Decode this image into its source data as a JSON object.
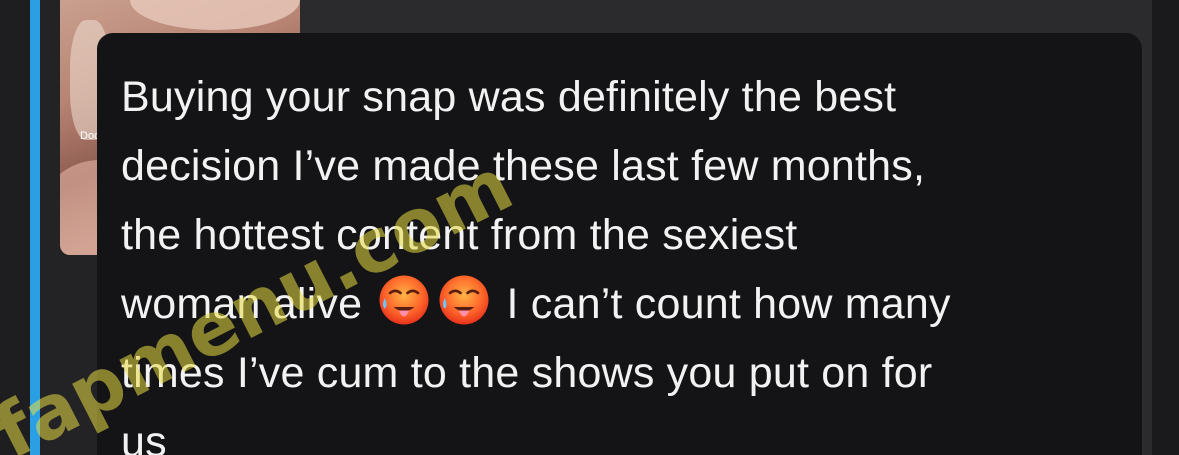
{
  "thumbnail": {
    "label": "Doc"
  },
  "message": {
    "line1": "Buying your snap was definitely the best",
    "line2": "decision I’ve made these last few months,",
    "line3": "the hottest content from the sexiest",
    "line4_start": "woman alive ",
    "line4_end": " I can’t count how many",
    "line5": "times I’ve cum to the shows you put on for",
    "line6": "us",
    "emoji_icons": [
      "drooling-hot-face-emoji",
      "drooling-hot-face-emoji"
    ]
  },
  "watermark": {
    "text": "fapmenu.com"
  },
  "colors": {
    "accent": "#2a9fe3",
    "bubble": "#141416",
    "panel": "#2b2b2e",
    "text": "#f2f2f2",
    "watermark": "#e8dc46"
  }
}
